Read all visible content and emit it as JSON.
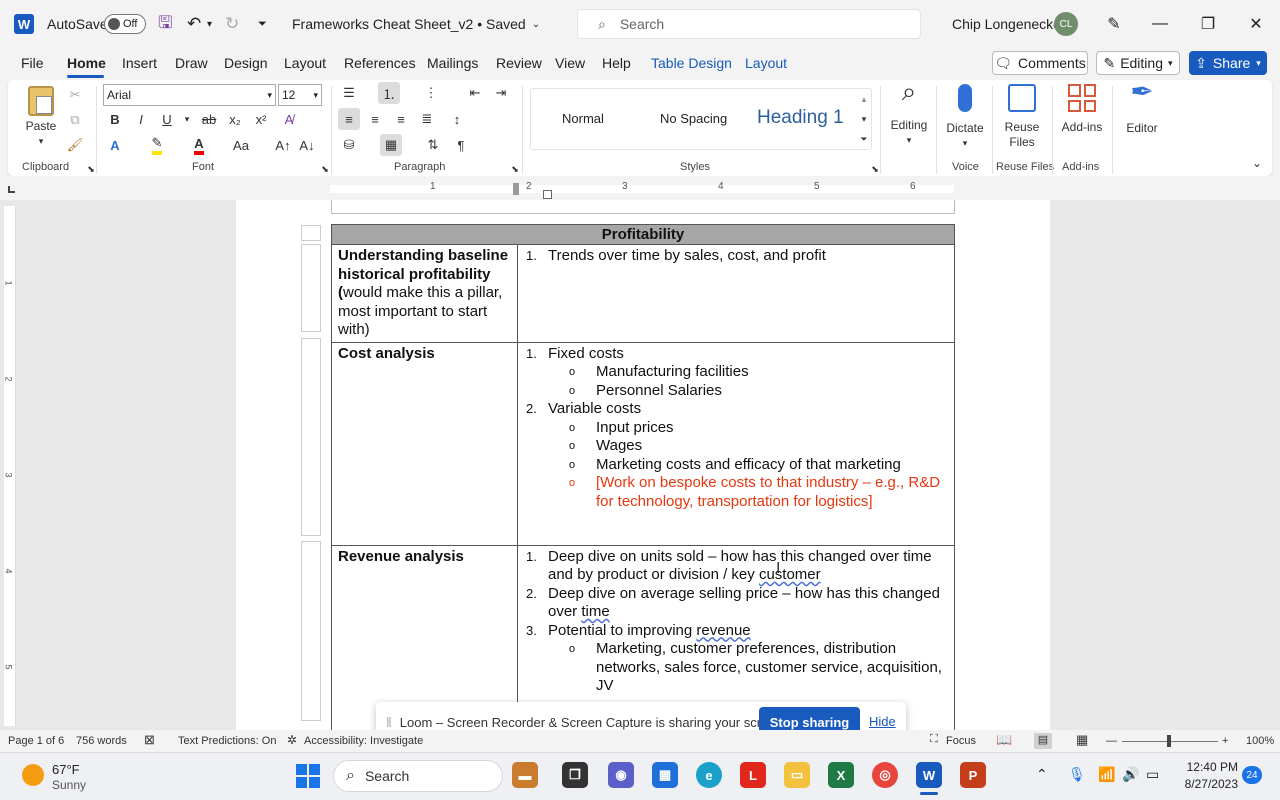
{
  "app": {
    "autosave_label": "AutoSave",
    "autosave_state": "Off",
    "doc_title": "Frameworks Cheat Sheet_v2 • Saved",
    "search_placeholder": "Search",
    "user_name": "Chip Longenecker",
    "user_initials": "CL"
  },
  "menu": {
    "tabs": [
      "File",
      "Home",
      "Insert",
      "Draw",
      "Design",
      "Layout",
      "References",
      "Mailings",
      "Review",
      "View",
      "Help",
      "Table Design",
      "Layout"
    ],
    "comments_label": "Comments",
    "editing_label": "Editing",
    "share_label": "Share"
  },
  "ribbon": {
    "paste_label": "Paste",
    "clipboard_label": "Clipboard",
    "font_name": "Arial",
    "font_size": "12",
    "font_group_label": "Font",
    "paragraph_label": "Paragraph",
    "styles": [
      "Normal",
      "No Spacing",
      "Heading 1"
    ],
    "styles_label": "Styles",
    "editing_btn": "Editing",
    "dictate_btn": "Dictate",
    "voice_label": "Voice",
    "reuse_btn_line1": "Reuse",
    "reuse_btn_line2": "Files",
    "reuse_label": "Reuse Files",
    "addins_btn": "Add-ins",
    "addins_label": "Add-ins",
    "editor_btn": "Editor",
    "bold": "B",
    "italic": "I",
    "underline": "U",
    "strike": "ab",
    "subscript": "x₂",
    "superscript": "x²"
  },
  "ruler": {
    "numbers": [
      "1",
      "2",
      "3",
      "4",
      "5",
      "6"
    ],
    "vnumbers": [
      "1",
      "2",
      "3",
      "4",
      "5"
    ]
  },
  "table": {
    "header": "Profitability",
    "rows": [
      {
        "left_bold": "Understanding baseline historical profitability (",
        "left_normal": "would make this a pillar, most important to start with)",
        "items": [
          {
            "n": "1.",
            "text": "Trends over time by sales, cost, and profit"
          }
        ]
      },
      {
        "left_bold": "Cost analysis",
        "items": [
          {
            "n": "1.",
            "text": "Fixed costs",
            "subs": [
              "Manufacturing facilities",
              "Personnel Salaries"
            ]
          },
          {
            "n": "2.",
            "text": "Variable costs",
            "subs": [
              "Input prices",
              "Wages",
              "Marketing costs and efficacy of that marketing"
            ],
            "red_sub": "[Work on bespoke costs to that industry – e.g., R&D for technology, transportation for logistics]"
          }
        ]
      },
      {
        "left_bold": "Revenue analysis",
        "items": [
          {
            "n": "1.",
            "text": "Deep dive on units sold – how has this changed over time and by product or division / key ",
            "tail": "customer"
          },
          {
            "n": "2.",
            "text": "Deep dive on average selling price – how has this changed over ",
            "tail": "time"
          },
          {
            "n": "3.",
            "text": "Potential to improving ",
            "tail": "revenue",
            "subs": [
              "Marketing, customer preferences, distribution networks, sales force, customer service, acquisition, JV"
            ]
          }
        ]
      }
    ]
  },
  "loom": {
    "message": "Loom – Screen Recorder & Screen Capture is sharing your screen.",
    "stop_label": "Stop sharing",
    "hide_label": "Hide"
  },
  "status": {
    "page": "Page 1 of 6",
    "words": "756 words",
    "text_predictions": "Text Predictions: On",
    "accessibility": "Accessibility: Investigate",
    "focus": "Focus",
    "zoom": "100%"
  },
  "taskbar": {
    "weather_temp": "67°F",
    "weather_desc": "Sunny",
    "search_label": "Search",
    "time": "12:40 PM",
    "date": "8/27/2023",
    "notifications": "24"
  }
}
